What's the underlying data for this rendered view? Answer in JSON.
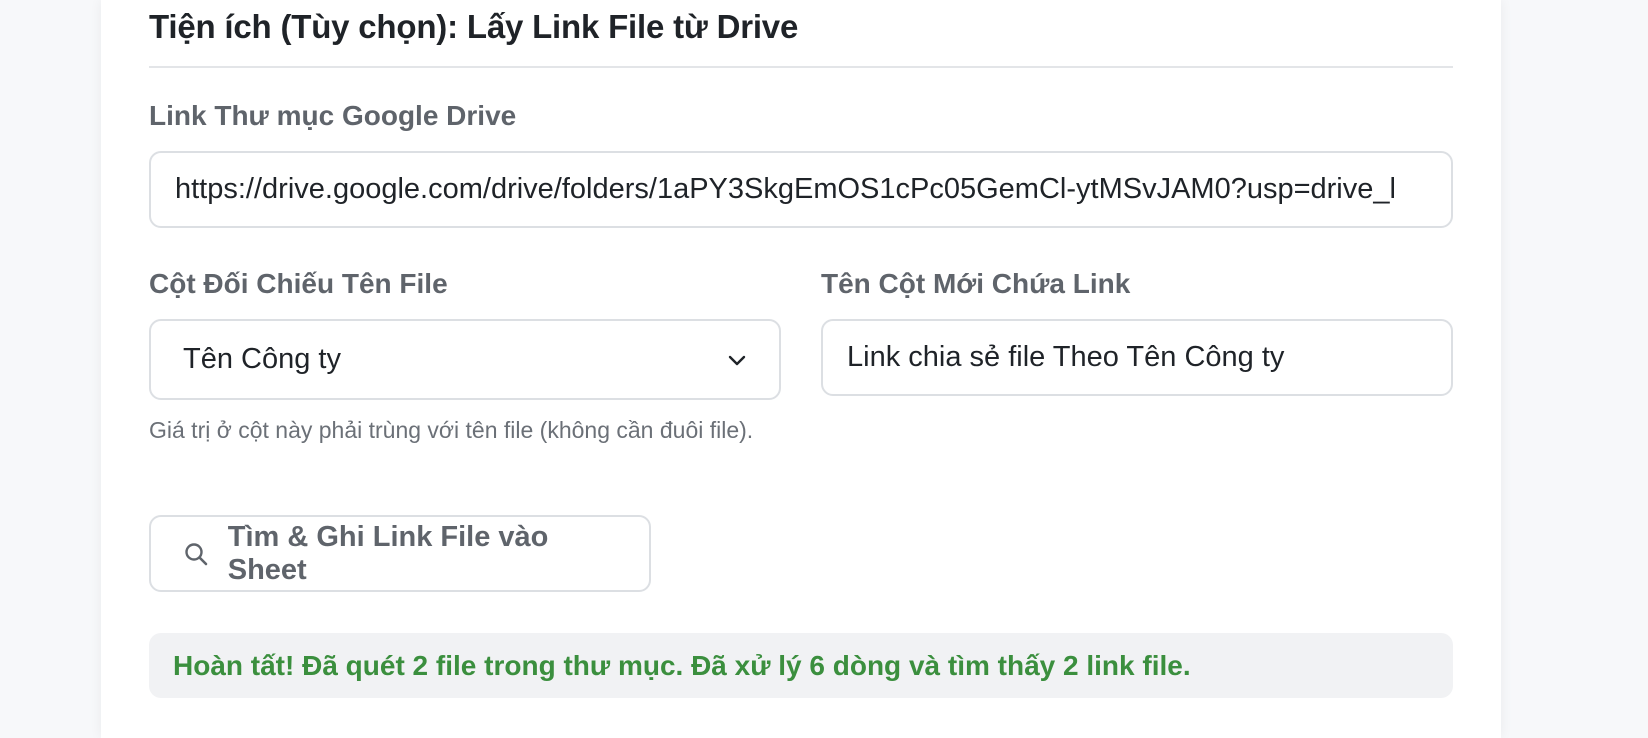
{
  "section": {
    "title": "Tiện ích (Tùy chọn): Lấy Link File từ Drive"
  },
  "drive_folder": {
    "label": "Link Thư mục Google Drive",
    "value": "https://drive.google.com/drive/folders/1aPY3SkgEmOS1cPc05GemCl-ytMSvJAM0?usp=drive_l"
  },
  "match_column": {
    "label": "Cột Đối Chiếu Tên File",
    "selected": "Tên Công ty",
    "hint": "Giá trị ở cột này phải trùng với tên file (không cần đuôi file)."
  },
  "new_column": {
    "label": "Tên Cột Mới Chứa Link",
    "value": "Link chia sẻ file Theo Tên Công ty"
  },
  "action": {
    "label": "Tìm & Ghi Link File vào Sheet",
    "icon": "search-icon"
  },
  "status": {
    "message": "Hoàn tất! Đã quét 2 file trong thư mục. Đã xử lý 6 dòng và tìm thấy 2 link file.",
    "color": "#3b8f3e"
  }
}
